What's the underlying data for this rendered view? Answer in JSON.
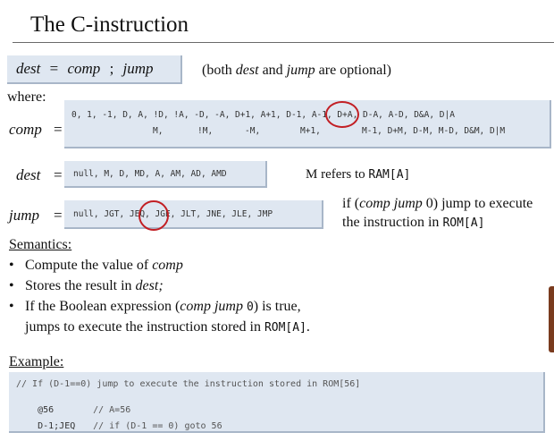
{
  "title": "The C-instruction",
  "syntax": {
    "dest": "dest",
    "eq": "=",
    "comp": "comp",
    "semi": ";",
    "jump": "jump",
    "note_pre": "(both",
    "note_dest": "dest",
    "note_and": "and",
    "note_jump": "jump",
    "note_post": "are optional)"
  },
  "where": "where:",
  "comp": {
    "label": "comp",
    "eq": "=",
    "row1": "0, 1, -1, D, A, !D, !A, -D, -A, D+1, A+1, D-1, A-1, D+A, D-A, A-D, D&A, D|A",
    "row2": [
      {
        "text": "M,"
      },
      {
        "text": "!M,"
      },
      {
        "text": "-M,"
      },
      {
        "text": "M+1,"
      },
      {
        "text": "M-1, D+M, D-M, M-D, D&M, D|M"
      }
    ]
  },
  "dest": {
    "label": "dest",
    "eq": "=",
    "values": "null, M, D, MD, A, AM, AD, AMD",
    "note_pre": "M refers to",
    "note_code": "RAM[A]"
  },
  "jump": {
    "label": "jump",
    "eq": "=",
    "values": "null, JGT, JEQ, JGE, JLT, JNE, JLE, JMP",
    "note1_pre": "if (",
    "note1_ital": "comp jump",
    "note1_post": "0) jump to execute",
    "note2_pre": "the instruction in",
    "note2_code": "ROM[A]"
  },
  "semantics": {
    "heading": "Semantics:",
    "b1_pre": "Compute the value of",
    "b1_ital": "comp",
    "b2_pre": "Stores the result in",
    "b2_ital": "dest;",
    "b3_pre": "If the Boolean expression (",
    "b3_ital": "comp jump",
    "b3_code": "0",
    "b3_post": ") is true,",
    "b4_pre": "jumps to execute the instruction stored in",
    "b4_code": "ROM[A]",
    "b4_post": "."
  },
  "example": {
    "heading": "Example:",
    "line1": "// If (D-1==0) jump to execute the instruction stored in ROM[56]",
    "line2_code": "@56",
    "line2_comment": "// A=56",
    "line3_code": "D-1;JEQ",
    "line3_comment": "// if (D-1 == 0) goto 56"
  },
  "colors": {
    "box": "#dfe7f1",
    "circle": "#c21f24",
    "rule": "#6a6a6a"
  }
}
